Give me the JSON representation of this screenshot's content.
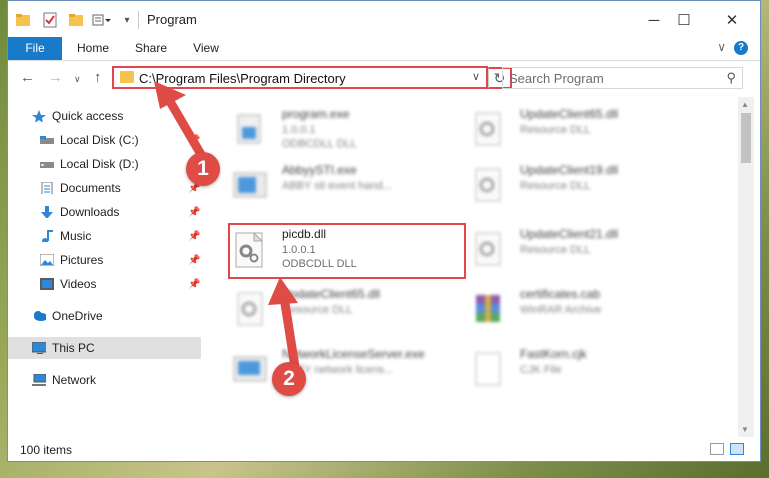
{
  "window": {
    "title": "Program",
    "controls": {
      "minimize": "─",
      "maximize": "☐",
      "close": "✕"
    }
  },
  "ribbon": {
    "tabs": [
      "File",
      "Home",
      "Share",
      "View"
    ],
    "help": "?",
    "collapse": "∨"
  },
  "nav": {
    "back": "←",
    "forward": "→",
    "recent": "∨",
    "up": "↑",
    "address": "C:\\Program Files\\Program Directory",
    "dropdown": "∨",
    "refresh": "↻",
    "search_placeholder": "Search Program",
    "search_icon": "⚲"
  },
  "sidebar": {
    "items": [
      {
        "label": "Quick access",
        "icon": "star-icon",
        "pinned": false
      },
      {
        "label": "Local Disk (C:)",
        "icon": "drive-icon",
        "pinned": true
      },
      {
        "label": "Local Disk (D:)",
        "icon": "drive-icon",
        "pinned": true
      },
      {
        "label": "Documents",
        "icon": "documents-icon",
        "pinned": true
      },
      {
        "label": "Downloads",
        "icon": "downloads-icon",
        "pinned": true
      },
      {
        "label": "Music",
        "icon": "music-icon",
        "pinned": true
      },
      {
        "label": "Pictures",
        "icon": "pictures-icon",
        "pinned": true
      },
      {
        "label": "Videos",
        "icon": "videos-icon",
        "pinned": true
      },
      {
        "label": "OneDrive",
        "icon": "cloud-icon",
        "pinned": false
      },
      {
        "label": "This PC",
        "icon": "computer-icon",
        "pinned": false,
        "selected": true
      },
      {
        "label": "Network",
        "icon": "network-icon",
        "pinned": false
      }
    ],
    "pin_glyph": "📌"
  },
  "files": [
    {
      "name": "program.exe",
      "line1": "1.0.0.1",
      "line2": "ODBCDLL DLL",
      "blurred": true
    },
    {
      "name": "UpdateClient65.dll",
      "line1": "Resource DLL",
      "line2": "",
      "blurred": true
    },
    {
      "name": "AbbyySTI.exe",
      "line1": "ABBY sti event hand...",
      "line2": "",
      "blurred": true
    },
    {
      "name": "UpdateClient19.dll",
      "line1": "Resource DLL",
      "line2": "",
      "blurred": true
    },
    {
      "name": "picdb.dll",
      "line1": "1.0.0.1",
      "line2": "ODBCDLL DLL",
      "blurred": false
    },
    {
      "name": "UpdateClient21.dll",
      "line1": "Resource DLL",
      "line2": "",
      "blurred": true
    },
    {
      "name": "UpdateClient65.dll",
      "line1": "Resource DLL",
      "line2": "",
      "blurred": true
    },
    {
      "name": "certificates.cab",
      "line1": "WinRAR Archive",
      "line2": "",
      "blurred": true
    },
    {
      "name": "NetworkLicenseServer.exe",
      "line1": "NETY network licens...",
      "line2": "",
      "blurred": true
    },
    {
      "name": "FastKorn.cjk",
      "line1": "CJK File",
      "line2": "",
      "blurred": true
    }
  ],
  "status": {
    "items": "100 items"
  },
  "annotations": {
    "step1": "1",
    "step2": "2"
  },
  "colors": {
    "accent": "#1979ca",
    "highlight": "#e0464c",
    "badge": "#df4b45",
    "folder": "#f4c44e"
  }
}
